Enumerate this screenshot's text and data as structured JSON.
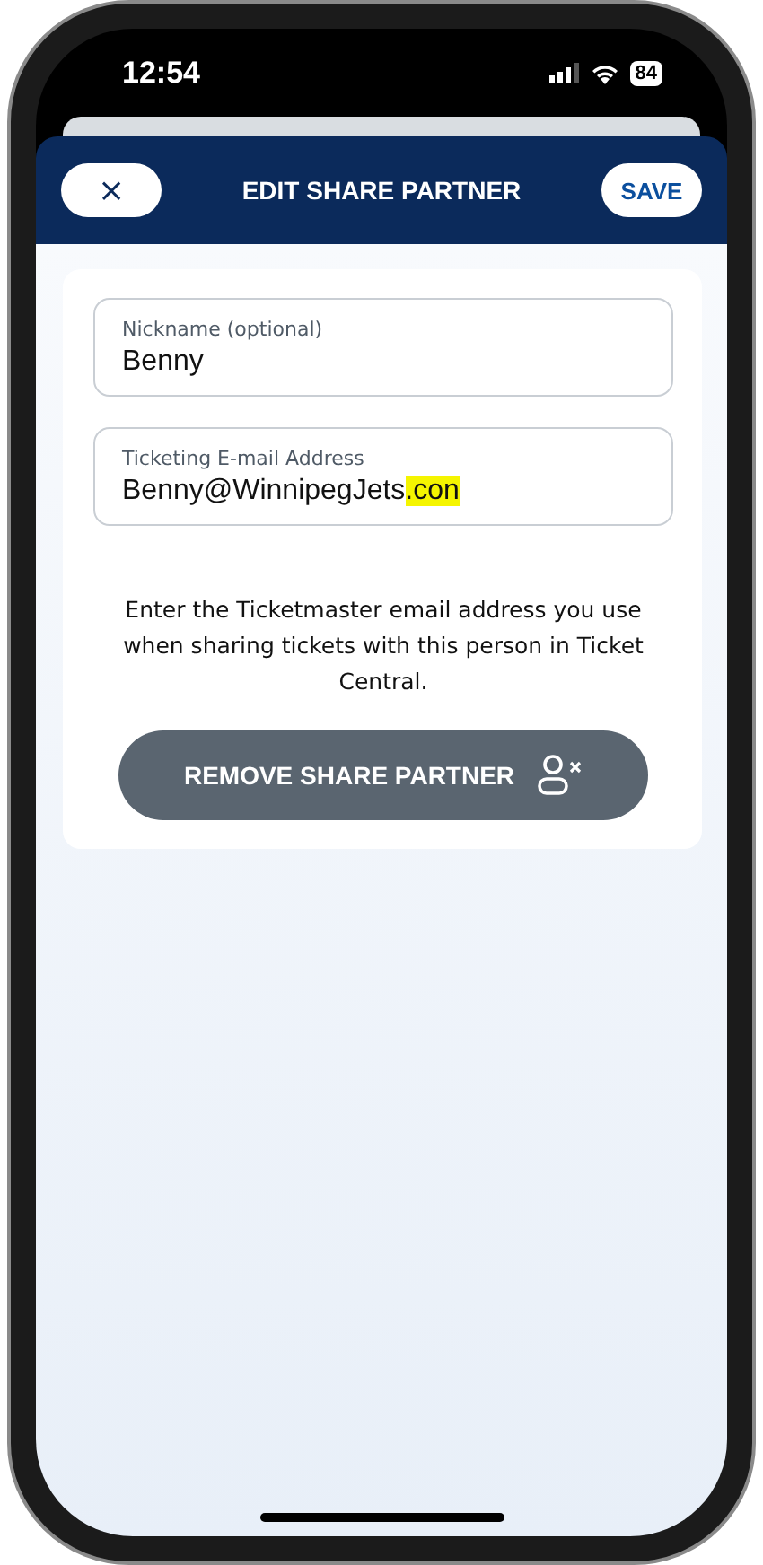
{
  "status_bar": {
    "time": "12:54",
    "battery": "84"
  },
  "header": {
    "title": "EDIT SHARE PARTNER",
    "close_label": "×",
    "save_label": "SAVE"
  },
  "fields": [
    {
      "label": "Nickname (optional)",
      "value": "Benny"
    },
    {
      "label": "Ticketing E-mail Address",
      "value": "Benny@WinnipegJets",
      "highlighted_suffix": ".con"
    }
  ],
  "help_text": "Enter the Ticketmaster email address you use when sharing tickets with this person in Ticket Central.",
  "remove_button": {
    "label": "REMOVE SHARE PARTNER"
  }
}
